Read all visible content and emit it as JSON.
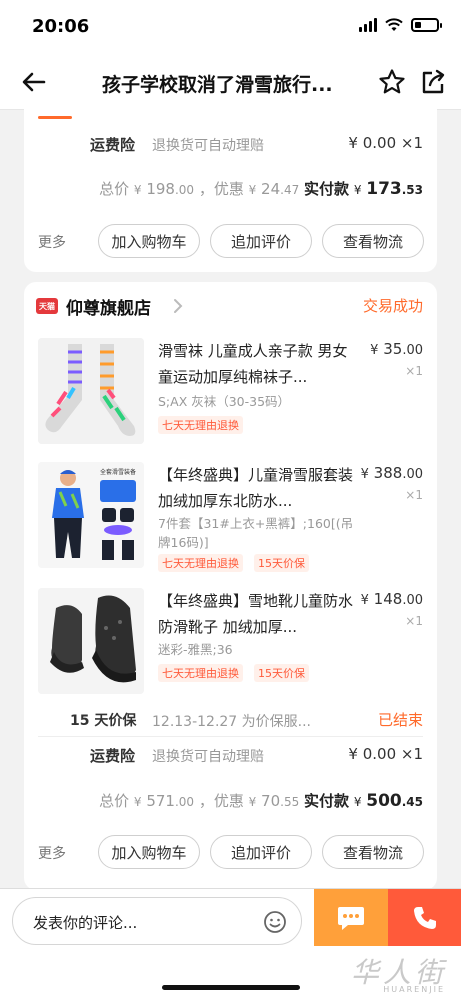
{
  "status_bar": {
    "time": "20:06"
  },
  "nav": {
    "title": "孩子学校取消了滑雪旅行..."
  },
  "order1": {
    "shipping_label": "运费险",
    "shipping_desc": "退换货可自动理赔",
    "shipping_price": "¥ 0.00 ×1",
    "total_label": "总价",
    "total_currency": "¥",
    "total_int": "198",
    "total_dec": ".00",
    "discount_label": "，优惠",
    "discount_currency": "¥",
    "discount_int": "24",
    "discount_dec": ".47",
    "paid_label": "实付款",
    "paid_currency": "¥",
    "paid_int": "173",
    "paid_dec": ".53",
    "more": "更多",
    "buttons": [
      "加入购物车",
      "追加评价",
      "查看物流"
    ]
  },
  "order2": {
    "badge": "天猫",
    "shop_name": "仰尊旗舰店",
    "status": "交易成功",
    "items": [
      {
        "title": "滑雪袜 儿童成人亲子款 男女童运动加厚纯棉袜子...",
        "price_currency": "¥",
        "price_int": "35",
        "price_dec": ".00",
        "qty": "×1",
        "sku": "S;AX 灰袜（30-35码）",
        "tags": [
          "七天无理由退换"
        ]
      },
      {
        "title": "【年终盛典】儿童滑雪服套装加绒加厚东北防水...",
        "price_currency": "¥",
        "price_int": "388",
        "price_dec": ".00",
        "qty": "×1",
        "sku": "7件套【31#上衣+黑裤】;160[(吊牌16码)]",
        "tags": [
          "七天无理由退换",
          "15天价保"
        ]
      },
      {
        "title": "【年终盛典】雪地靴儿童防水防滑靴子 加绒加厚...",
        "price_currency": "¥",
        "price_int": "148",
        "price_dec": ".00",
        "qty": "×1",
        "sku": "迷彩-雅黑;36",
        "tags": [
          "七天无理由退换",
          "15天价保"
        ]
      }
    ],
    "guarantee_label": "15 天价保",
    "guarantee_desc": "12.13-12.27 为价保服...",
    "guarantee_status": "已结束",
    "shipping_label": "运费险",
    "shipping_desc": "退换货可自动理赔",
    "shipping_price": "¥ 0.00 ×1",
    "total_label": "总价",
    "total_currency": "¥",
    "total_int": "571",
    "total_dec": ".00",
    "discount_label": "，优惠",
    "discount_currency": "¥",
    "discount_int": "70",
    "discount_dec": ".55",
    "paid_label": "实付款",
    "paid_currency": "¥",
    "paid_int": "500",
    "paid_dec": ".45",
    "more": "更多",
    "buttons": [
      "加入购物车",
      "追加评价",
      "查看物流"
    ]
  },
  "bottom": {
    "comment_placeholder": "发表你的评论...",
    "watermark": "华人街",
    "watermark_sub": "HUARENJIE"
  },
  "colors": {
    "accent": "#ff6a2b",
    "chat": "#ffa03a",
    "call": "#ff5a3a"
  },
  "icons": [
    "back-arrow-icon",
    "star-icon",
    "share-icon",
    "chevron-right-icon",
    "emoji-icon",
    "chat-icon",
    "phone-icon"
  ]
}
